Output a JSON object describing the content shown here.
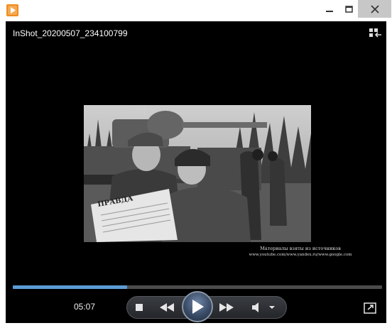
{
  "window": {
    "title_icon": "media-player-icon",
    "minimize_icon": "minimize-icon",
    "maximize_icon": "maximize-icon",
    "close_icon": "close-icon"
  },
  "media": {
    "title": "InShot_20200507_234100799",
    "caption_line1": "Материалы взяты из источников",
    "caption_line2": "www.youtube.com/www.yandex.ru/www.google.com",
    "poster_text": "ПРАВДА"
  },
  "player": {
    "current_time": "05:07",
    "progress": 0.31,
    "accent_color": "#5b9bd5",
    "controls": {
      "stop_icon": "stop-icon",
      "previous_icon": "previous-icon",
      "play_icon": "play-icon",
      "next_icon": "next-icon",
      "volume_icon": "volume-icon",
      "volume_menu_icon": "chevron-down-icon",
      "fullscreen_icon": "fullscreen-icon",
      "switch_to_library_icon": "switch-to-library-icon"
    }
  }
}
